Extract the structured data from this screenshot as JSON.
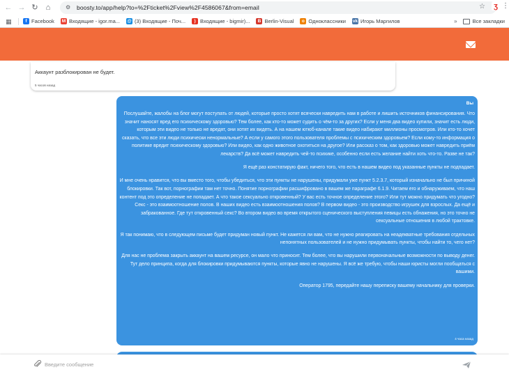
{
  "browser": {
    "url": "boosty.to/app/help?to=%2Fticket%2Fview%2F4586067&from=email",
    "bookmarks": [
      {
        "label": "Facebook",
        "icon": "facebook-icon",
        "color": "#1877f2",
        "glyph": "f"
      },
      {
        "label": "Входящие - igor.ma...",
        "icon": "gmail-icon",
        "color": "#ea4335",
        "glyph": "M"
      },
      {
        "label": "(3) Входящие - Поч...",
        "icon": "mail-ru-icon",
        "color": "#168de2",
        "glyph": "@"
      },
      {
        "label": "Входящие - bigmir)...",
        "icon": "bigmir-icon",
        "color": "#e63323",
        "glyph": ")"
      },
      {
        "label": "Berlin-Visual",
        "icon": "berlin-visual-icon",
        "color": "#d4372c",
        "glyph": "B"
      },
      {
        "label": "Одноклассники",
        "icon": "odnoklassniki-icon",
        "color": "#ee8208",
        "glyph": "o"
      },
      {
        "label": "Игорь Маргилов",
        "icon": "vk-icon",
        "color": "#4a76a8",
        "glyph": "vk"
      }
    ],
    "more_label": "»",
    "other_bookmarks": "Все закладки"
  },
  "header": {
    "accent_color": "#f26b3a"
  },
  "chat": {
    "incoming": {
      "text": "Аккаунт разблокирован не будет.",
      "time": "5 часов назад"
    },
    "outgoing": {
      "sender": "Вы",
      "paragraphs": [
        "Послушайте, жалобы на блог могут поступать от людей, которые просто хотят всячески навредить нам в работе и лишить источников финансирования. Что значит наносят вред его психическому здоровью? Тем более, как кто-то может судить о чём-то за других? Если у меня два видео купили, значит есть люди, которым эти видео не только не вредят, они хотят их видеть. А на нашем ютюб-канале такие видео набирают миллионы просмотров. Или кто-то хочет сказать, что все эти люди психически ненормальные? А если у самого этого пользователя проблемы с психическим здоровьем? Если кому-то информация о политике вредит психическому здоровью? Или видео, как одно животное охотиться на другое? Или рассказ о том, как здоровью может навредить приём лекарств? Да всё может навредить чей-то психике, особенно если есть желание найти хоть что-то. Разве не так?",
        "Я ещё раз констатирую факт, ничего того, что есть в нашем видео под указанные пункты не подпадает.",
        "И мне очень нравится, что вы вместо того, чтобы убедиться, что эти пункты не нарушены, придумали уже пункт 5.2.3.7, который изначально не был причиной блокировки. Так вот, порнографии там нет точно. Понятие порнографии расшифровано в вашем же параграфе 6.1.9. Читаем его и обнаруживаем, что наш контент под это определение не попадает. А что такое сексуально откровенный? У вас есть точное определение этого? Или тут можно придумать что угодно? Секс - это взаимоотношение полов. В наших видео есть взаимоотношения полов? В первом видео - это производство игрушек для взрослых. Да ещё и забракованное. Где тут откровенный секс? Во втором видео во время открытого сценического выступления певицы есть обнажения, но это точно не сексуальные отношения в любой трактовке.",
        "Я так понимаю, что в следующем письме будет придуман новый пункт. Не кажется ли вам, что не нужно реагировать на неадекватные требования отдельных непонятных пользователей и не нужно придумывать пункты, чтобы найти то, чего нет?",
        "Для нас не проблема закрыть аккаунт на вашем ресурсе, он мало что приносит. Тем более, что вы нарушили первоначальные возможности по выводу денег. Тут дело принципа, когда для блокировки придумываются пункты, которые явно не нарушены. Я всё же требую, чтобы наши юристы могли пообщаться с вашими.",
        "Оператор 1795, передайте нашу переписку вашему начальнику для проверки."
      ],
      "time": "4 часа назад",
      "bubble_color": "#3b93e0"
    }
  },
  "composer": {
    "placeholder": "Введите сообщение"
  }
}
